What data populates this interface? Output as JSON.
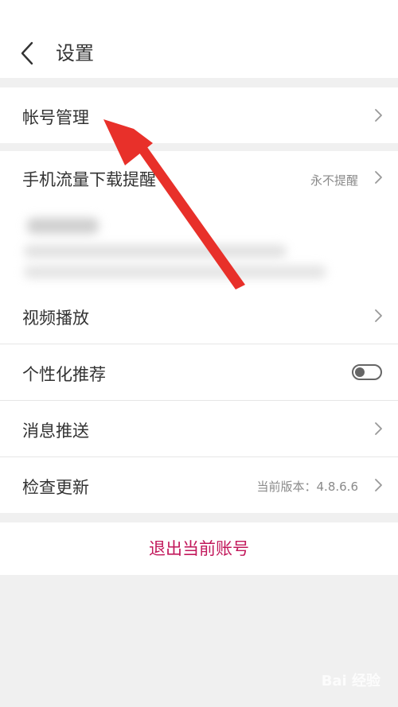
{
  "header": {
    "title": "设置",
    "back_icon": "back-chevron-icon"
  },
  "rows": {
    "account": {
      "label": "帐号管理"
    },
    "mobile_data": {
      "label": "手机流量下载提醒",
      "value": "永不提醒"
    },
    "video_playback": {
      "label": "视频播放"
    },
    "personalized": {
      "label": "个性化推荐",
      "toggle_on": false
    },
    "push": {
      "label": "消息推送"
    },
    "update": {
      "label": "检查更新",
      "value": "当前版本：4.8.6.6"
    }
  },
  "logout": {
    "label": "退出当前账号"
  },
  "annotation": {
    "color": "#e8302a"
  },
  "colors": {
    "logout_text": "#c2185b",
    "background": "#f0f0f0"
  },
  "watermark": {
    "text": "Bai 经验"
  }
}
